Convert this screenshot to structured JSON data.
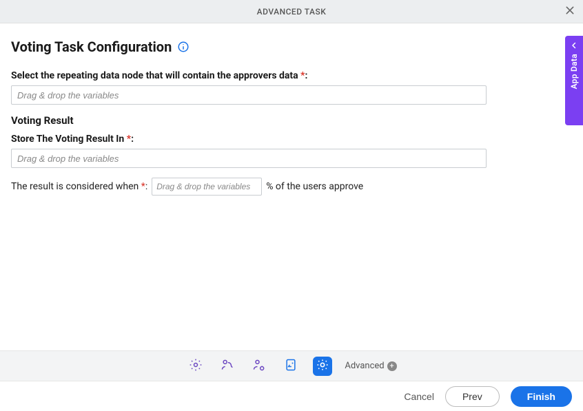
{
  "header": {
    "title": "ADVANCED TASK"
  },
  "page": {
    "title": "Voting Task Configuration"
  },
  "form": {
    "approvers_label": "Select the repeating data node that will contain the approvers data",
    "approvers_placeholder": "Drag & drop the variables",
    "voting_result_heading": "Voting Result",
    "store_label": "Store The Voting Result In",
    "store_placeholder": "Drag & drop the variables",
    "threshold_prefix": "The result is considered when",
    "threshold_placeholder": "Drag & drop the variables",
    "threshold_suffix": "% of the users approve",
    "required_marker": " *",
    "colon": ":"
  },
  "side_panel": {
    "label": "App Data"
  },
  "stepper": {
    "advanced_label": "Advanced"
  },
  "footer": {
    "cancel": "Cancel",
    "prev": "Prev",
    "finish": "Finish"
  }
}
